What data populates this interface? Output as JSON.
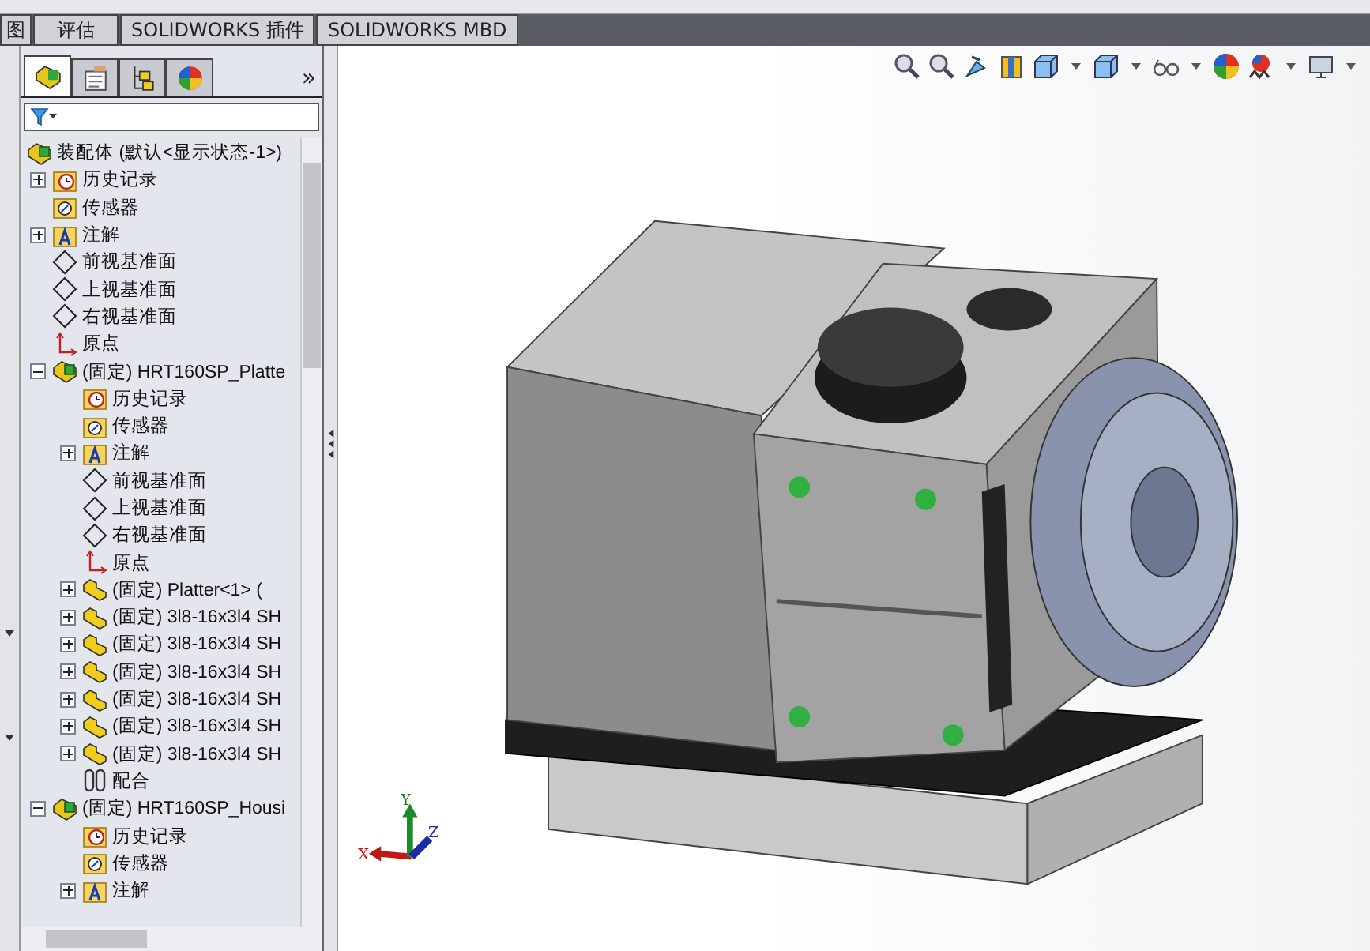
{
  "command_tabs": [
    "图",
    "评估",
    "SOLIDWORKS 插件",
    "SOLIDWORKS MBD"
  ],
  "panel_tabs": [
    {
      "kind": "feature-tree",
      "selected": true
    },
    {
      "kind": "property",
      "selected": false
    },
    {
      "kind": "configuration",
      "selected": false
    },
    {
      "kind": "display",
      "selected": false
    }
  ],
  "panel_more": "»",
  "tree": {
    "kind": "assembly",
    "label": "装配体 (默认<显示状态-1>)",
    "children": [
      {
        "kind": "history",
        "label": "历史记录",
        "expanded": false
      },
      {
        "kind": "sensor",
        "label": "传感器"
      },
      {
        "kind": "annotation",
        "label": "注解",
        "expanded": false
      },
      {
        "kind": "plane",
        "label": "前视基准面"
      },
      {
        "kind": "plane",
        "label": "上视基准面"
      },
      {
        "kind": "plane",
        "label": "右视基准面"
      },
      {
        "kind": "origin",
        "label": "原点"
      },
      {
        "kind": "assembly",
        "label": "(固定) HRT160SP_Platte",
        "expanded": true,
        "children": [
          {
            "kind": "history",
            "label": "历史记录"
          },
          {
            "kind": "sensor",
            "label": "传感器"
          },
          {
            "kind": "annotation",
            "label": "注解",
            "expanded": false
          },
          {
            "kind": "plane",
            "label": "前视基准面"
          },
          {
            "kind": "plane",
            "label": "上视基准面"
          },
          {
            "kind": "plane",
            "label": "右视基准面"
          },
          {
            "kind": "origin",
            "label": "原点"
          },
          {
            "kind": "part",
            "label": "(固定) Platter<1> (",
            "expanded": false
          },
          {
            "kind": "part",
            "label": "(固定) 3l8-16x3l4 SH",
            "expanded": false
          },
          {
            "kind": "part",
            "label": "(固定) 3l8-16x3l4 SH",
            "expanded": false
          },
          {
            "kind": "part",
            "label": "(固定) 3l8-16x3l4 SH",
            "expanded": false
          },
          {
            "kind": "part",
            "label": "(固定) 3l8-16x3l4 SH",
            "expanded": false
          },
          {
            "kind": "part",
            "label": "(固定) 3l8-16x3l4 SH",
            "expanded": false
          },
          {
            "kind": "part",
            "label": "(固定) 3l8-16x3l4 SH",
            "expanded": false
          },
          {
            "kind": "mates",
            "label": "配合"
          }
        ]
      },
      {
        "kind": "assembly",
        "label": "(固定) HRT160SP_Housi",
        "expanded": true,
        "children": [
          {
            "kind": "history",
            "label": "历史记录"
          },
          {
            "kind": "sensor",
            "label": "传感器"
          },
          {
            "kind": "annotation",
            "label": "注解",
            "expanded": false
          }
        ]
      }
    ]
  },
  "triad": {
    "x": "X",
    "y": "Y",
    "z": "Z"
  }
}
